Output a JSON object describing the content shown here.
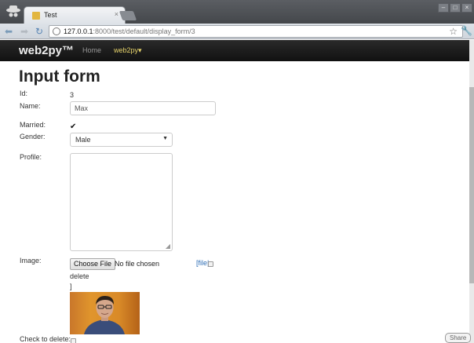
{
  "browser": {
    "tab_title": "Test",
    "tab_close": "×",
    "url_host": "127.0.0.1",
    "url_rest": ":8000/test/default/display_form/3",
    "window_buttons": [
      "–",
      "□",
      "×"
    ]
  },
  "navbar": {
    "brand": "web2py™",
    "home": "Home",
    "menu": "web2py▾"
  },
  "page": {
    "title": "Input form"
  },
  "form": {
    "id_label": "Id:",
    "id_value": "3",
    "name_label": "Name:",
    "name_value": "Max",
    "married_label": "Married:",
    "married_checked": true,
    "gender_label": "Gender:",
    "gender_value": "Male",
    "profile_label": "Profile:",
    "profile_value": "",
    "image_label": "Image:",
    "choose_file": "Choose File",
    "no_file": "No file chosen",
    "file_link": "[file|",
    "delete_text": "delete",
    "bracket": "]",
    "check_delete_label": "Check to delete:"
  },
  "share": "Share"
}
